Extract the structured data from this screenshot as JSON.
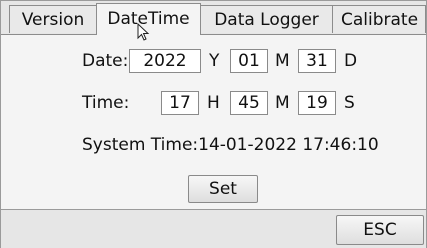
{
  "tabs": [
    {
      "label": "Version"
    },
    {
      "label": "DateTime"
    },
    {
      "label": "Data Logger"
    },
    {
      "label": "Calibrate"
    }
  ],
  "active_tab": "DateTime",
  "date": {
    "label": "Date:",
    "year": "2022",
    "year_unit": "Y",
    "month": "01",
    "month_unit": "M",
    "day": "31",
    "day_unit": "D"
  },
  "time": {
    "label": "Time:",
    "hour": "17",
    "hour_unit": "H",
    "minute": "45",
    "minute_unit": "M",
    "second": "19",
    "second_unit": "S"
  },
  "system_time": "System Time:14-01-2022 17:46:10",
  "set_label": "Set",
  "esc_label": "ESC",
  "icons": {
    "cursor": "mouse-pointer-icon"
  }
}
